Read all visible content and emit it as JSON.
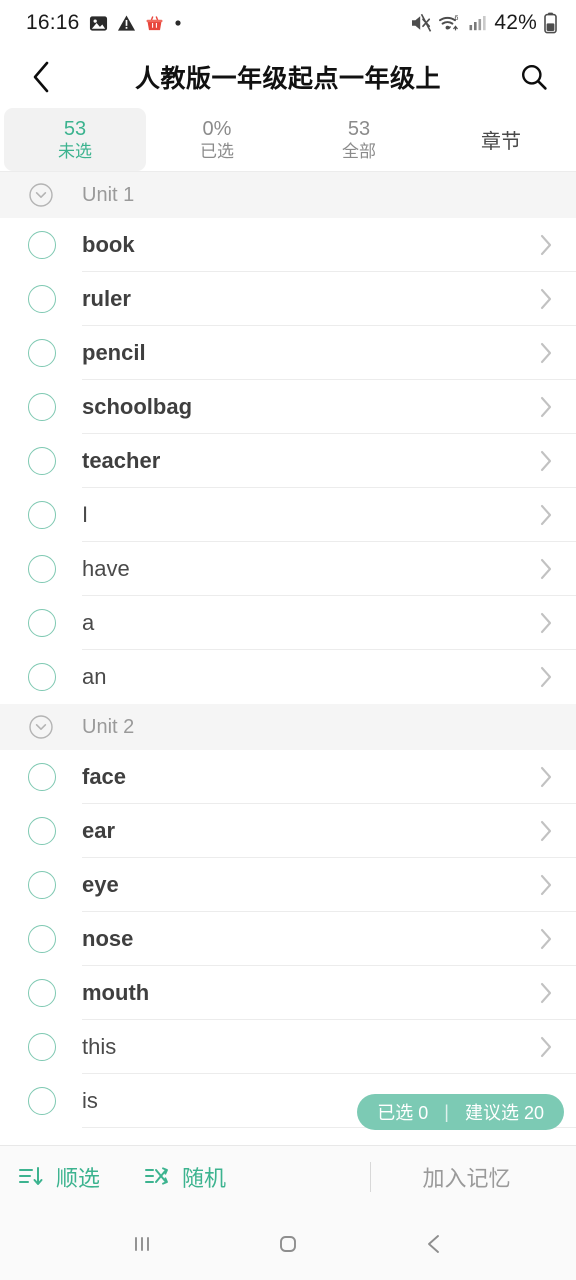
{
  "statusbar": {
    "time": "16:16",
    "battery_percent": "42%",
    "icons": [
      "image-icon",
      "warning-triangle-icon",
      "shopping-basket-icon",
      "dot-icon",
      "mute-icon",
      "wifi-6-icon",
      "signal-bars-icon",
      "battery-icon"
    ]
  },
  "header": {
    "back_icon": "chevron-left-icon",
    "title": "人教版一年级起点一年级上",
    "search_icon": "search-icon"
  },
  "tabs": [
    {
      "num": "53",
      "label": "未选",
      "active": true
    },
    {
      "num": "0%",
      "label": "已选",
      "active": false
    },
    {
      "num": "53",
      "label": "全部",
      "active": false
    },
    {
      "num": "",
      "label": "章节",
      "active": false,
      "single": true
    }
  ],
  "sections": [
    {
      "title": "Unit 1",
      "collapse_icon": "chevron-down-circle-icon",
      "words": [
        {
          "text": "book",
          "bold": true
        },
        {
          "text": "ruler",
          "bold": true
        },
        {
          "text": "pencil",
          "bold": true
        },
        {
          "text": "schoolbag",
          "bold": true
        },
        {
          "text": "teacher",
          "bold": true
        },
        {
          "text": "I",
          "bold": false
        },
        {
          "text": "have",
          "bold": false
        },
        {
          "text": "a",
          "bold": false
        },
        {
          "text": "an",
          "bold": false
        }
      ]
    },
    {
      "title": "Unit 2",
      "collapse_icon": "chevron-down-circle-icon",
      "words": [
        {
          "text": "face",
          "bold": true
        },
        {
          "text": "ear",
          "bold": true
        },
        {
          "text": "eye",
          "bold": true
        },
        {
          "text": "nose",
          "bold": true
        },
        {
          "text": "mouth",
          "bold": true
        },
        {
          "text": "this",
          "bold": false
        },
        {
          "text": "is",
          "bold": false
        }
      ]
    }
  ],
  "badge": {
    "selected_label": "已选 0",
    "separator": "|",
    "suggested_label": "建议选 20"
  },
  "toolbar": {
    "sort_label": "顺选",
    "sort_icon": "sort-descending-icon",
    "random_label": "随机",
    "random_icon": "shuffle-icon",
    "primary_label": "加入记忆"
  },
  "navbar": {
    "recents_icon": "recents-icon",
    "home_icon": "home-icon",
    "back_icon": "back-icon"
  },
  "colors": {
    "accent": "#3cb38f",
    "badge_bg": "#7ccab4",
    "circle_border": "#7fc9b2",
    "section_bg": "#f5f5f5",
    "muted": "#9a9a9a"
  }
}
